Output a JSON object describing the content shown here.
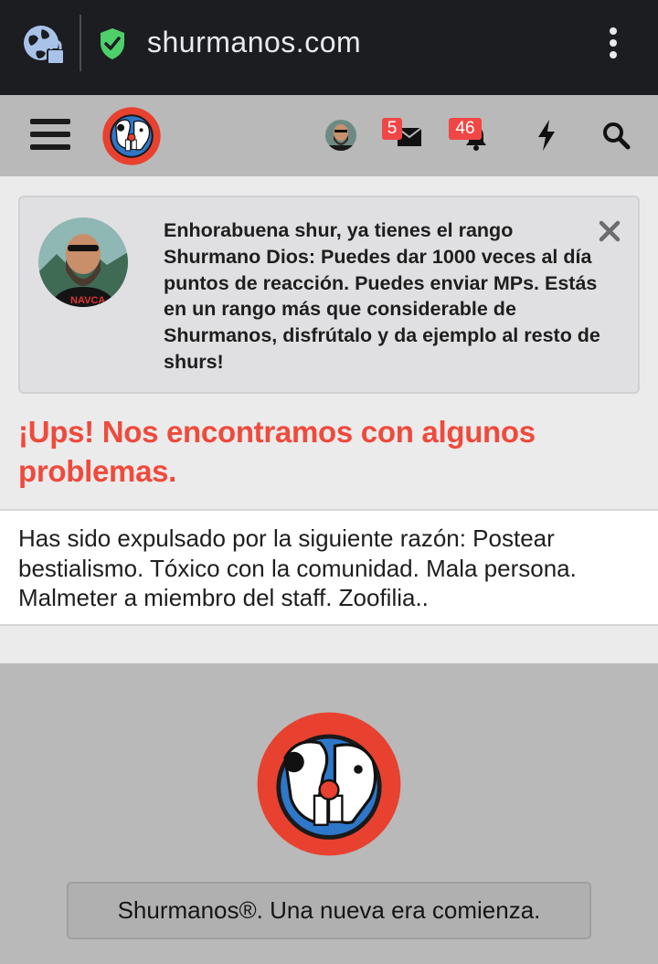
{
  "browser": {
    "url": "shurmanos.com",
    "icons": [
      "globe-lock-icon",
      "shield-check-icon",
      "kebab-menu-icon"
    ]
  },
  "header": {
    "icons": [
      "hamburger-menu-icon",
      "site-logo",
      "avatar",
      "inbox-icon",
      "bell-icon",
      "lightning-icon",
      "search-icon"
    ],
    "inbox_count": "5",
    "alerts_count": "46"
  },
  "notice": {
    "text": "Enhorabuena shur, ya tienes el rango Shurmano Dios: Puedes dar 1000 veces al día puntos de reacción. Puedes enviar MPs. Estás en un rango más que considerable de Shurmanos, disfrútalo y da ejemplo al resto de shurs!"
  },
  "error": {
    "title": "¡Ups! Nos encontramos con algunos problemas.",
    "reason": "Has sido expulsado por la siguiente razón: Postear bestialismo. Tóxico con la comunidad. Mala persona. Malmeter a miembro del staff. Zoofilia.."
  },
  "footer": {
    "slogan": "Shurmanos®. Una nueva era comienza."
  },
  "colors": {
    "accent": "#ef4a3c",
    "badge": "#f04646",
    "header_bg": "#b9b9b9",
    "browser_bg": "#1b1d21"
  }
}
